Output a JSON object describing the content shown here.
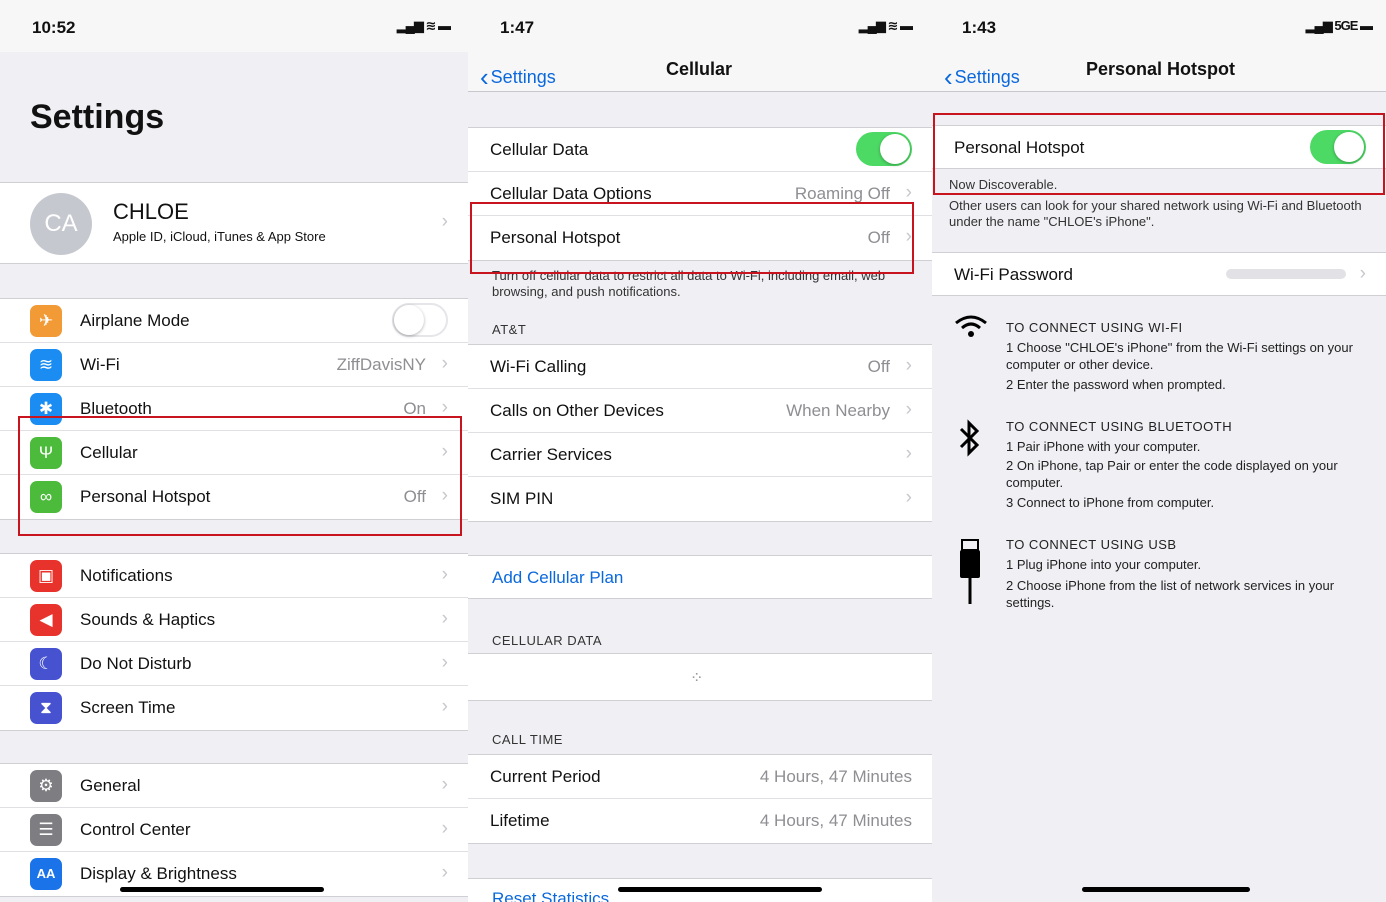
{
  "panel1": {
    "status": {
      "time": "10:52",
      "signal": "▂▄▆ ≋ ▬"
    },
    "title": "Settings",
    "profile": {
      "initials": "CA",
      "name": "CHLOE",
      "subtitle": "Apple ID, iCloud, iTunes & App Store"
    },
    "group1": [
      {
        "label": "Airplane Mode",
        "value": "",
        "icon": "airplane-icon",
        "color": "#f29a35",
        "glyph": "✈"
      },
      {
        "label": "Wi-Fi",
        "value": "ZiffDavisNY",
        "icon": "wifi-icon",
        "color": "#1a8cf2",
        "glyph": "≋"
      },
      {
        "label": "Bluetooth",
        "value": "On",
        "icon": "bluetooth-icon",
        "color": "#1a8cf2",
        "glyph": "✱"
      },
      {
        "label": "Cellular",
        "value": "",
        "icon": "cellular-antenna-icon",
        "color": "#4cba3b",
        "glyph": "Ψ"
      },
      {
        "label": "Personal Hotspot",
        "value": "Off",
        "icon": "hotspot-link-icon",
        "color": "#4cba3b",
        "glyph": "∞"
      }
    ],
    "group2": [
      {
        "label": "Notifications",
        "icon": "notifications-icon",
        "color": "#e7332b",
        "glyph": "▣"
      },
      {
        "label": "Sounds & Haptics",
        "icon": "speaker-icon",
        "color": "#e7332b",
        "glyph": "◀"
      },
      {
        "label": "Do Not Disturb",
        "icon": "moon-icon",
        "color": "#4652cf",
        "glyph": "☾"
      },
      {
        "label": "Screen Time",
        "icon": "hourglass-icon",
        "color": "#4652cf",
        "glyph": "⧗"
      }
    ],
    "group3": [
      {
        "label": "General",
        "icon": "gear-icon",
        "color": "#7d7d82",
        "glyph": "⚙"
      },
      {
        "label": "Control Center",
        "icon": "switches-icon",
        "color": "#7d7d82",
        "glyph": "☰"
      },
      {
        "label": "Display & Brightness",
        "icon": "display-aa-icon",
        "color": "#1a73e8",
        "glyph": "AA"
      }
    ]
  },
  "panel2": {
    "status": {
      "time": "1:47",
      "signal": "▂▄▆ ≋ ▬"
    },
    "nav": {
      "back": "Settings",
      "title": "Cellular"
    },
    "group1": [
      {
        "label": "Cellular Data",
        "value": "",
        "toggle": true
      },
      {
        "label": "Cellular Data Options",
        "value": "Roaming Off"
      },
      {
        "label": "Personal Hotspot",
        "value": "Off"
      }
    ],
    "footnote": "Turn off cellular data to restrict all data to Wi-Fi, including email, web browsing, and push notifications.",
    "carrier_header": "AT&T",
    "group2": [
      {
        "label": "Wi-Fi Calling",
        "value": "Off"
      },
      {
        "label": "Calls on Other Devices",
        "value": "When Nearby"
      },
      {
        "label": "Carrier Services",
        "value": ""
      },
      {
        "label": "SIM PIN",
        "value": ""
      }
    ],
    "add_plan": "Add Cellular Plan",
    "cellular_data_header": "CELLULAR DATA",
    "call_time_header": "CALL TIME",
    "group3": [
      {
        "label": "Current Period",
        "value": "4 Hours, 47 Minutes"
      },
      {
        "label": "Lifetime",
        "value": "4 Hours, 47 Minutes"
      }
    ],
    "reset": "Reset Statistics"
  },
  "panel3": {
    "status": {
      "time": "1:43",
      "signal": "▂▄▆ 5GE ▬"
    },
    "nav": {
      "back": "Settings",
      "title": "Personal Hotspot"
    },
    "hotspot_label": "Personal Hotspot",
    "discoverable": "Now Discoverable.",
    "discoverable_detail": "Other users can look for your shared network using Wi-Fi and Bluetooth under the name \"CHLOE's iPhone\".",
    "wifi_password_label": "Wi-Fi Password",
    "wifi_section": {
      "title": "TO CONNECT USING WI-FI",
      "step1": "1 Choose \"CHLOE's iPhone\" from the Wi-Fi settings on your computer or other device.",
      "step2": "2 Enter the password when prompted."
    },
    "bluetooth_section": {
      "title": "TO CONNECT USING BLUETOOTH",
      "step1": "1 Pair iPhone with your computer.",
      "step2": "2 On iPhone, tap Pair or enter the code displayed on your computer.",
      "step3": "3 Connect to iPhone from computer."
    },
    "usb_section": {
      "title": "TO CONNECT USING USB",
      "step1": "1 Plug iPhone into your computer.",
      "step2": "2 Choose iPhone from the list of network services in your settings."
    }
  },
  "colors": {
    "accent": "#0a68dd",
    "toggle_on": "#4cd964",
    "highlight": "#c8141f"
  }
}
